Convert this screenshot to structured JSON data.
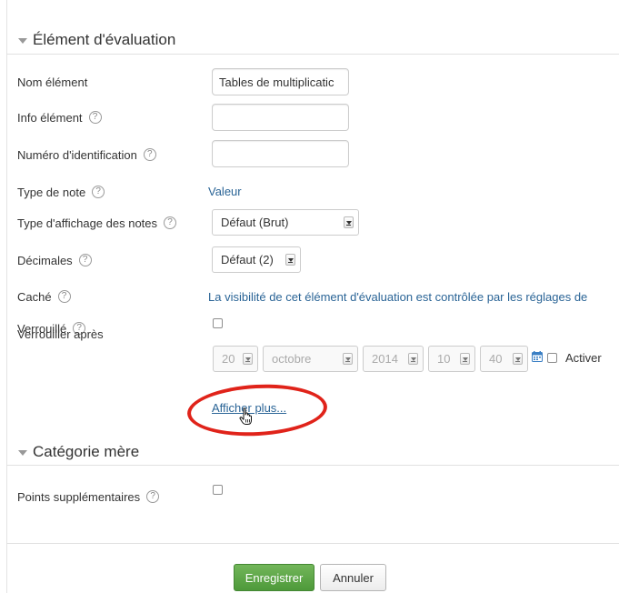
{
  "sections": {
    "grade_item": "Élément d'évaluation",
    "parent_category": "Catégorie mère"
  },
  "fields": {
    "item_name": {
      "label": "Nom élément",
      "value": "Tables de multiplicatic"
    },
    "item_info": {
      "label": "Info élément",
      "value": ""
    },
    "id_number": {
      "label": "Numéro d'identification",
      "value": ""
    },
    "grade_type": {
      "label": "Type de note",
      "value": "Valeur"
    },
    "grade_display": {
      "label": "Type d'affichage des notes",
      "value": "Défaut (Brut)"
    },
    "decimals": {
      "label": "Décimales",
      "value": "Défaut (2)"
    },
    "hidden": {
      "label": "Caché",
      "value": "La visibilité de cet élément d'évaluation est contrôlée par les réglages de"
    },
    "locked": {
      "label": "Verrouillé"
    },
    "lock_after": {
      "label": "Verrouiller après",
      "day": "20",
      "month": "octobre",
      "year": "2014",
      "hour": "10",
      "minute": "40",
      "enable_label": "Activer"
    },
    "extra_points": {
      "label": "Points supplémentaires"
    }
  },
  "show_more": "Afficher plus...",
  "buttons": {
    "save": "Enregistrer",
    "cancel": "Annuler"
  },
  "help_glyph": "?",
  "icons": [
    "help-icon",
    "calendar-icon",
    "hand-cursor-icon"
  ],
  "colors": {
    "link": "#2a6496",
    "primary": "#5aa846",
    "highlight": "#e0231a"
  }
}
